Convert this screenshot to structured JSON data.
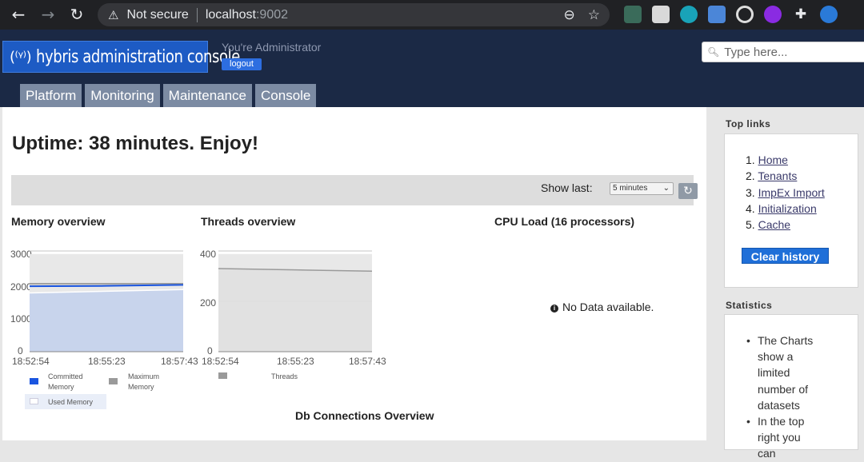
{
  "browser": {
    "security": "Not secure",
    "host": "localhost",
    "port": ":9002"
  },
  "header": {
    "logo_text": "hybris administration console",
    "user_text": "You're Administrator",
    "logout_label": "logout",
    "search_placeholder": "Type here...",
    "tabs": [
      "Platform",
      "Monitoring",
      "Maintenance",
      "Console"
    ]
  },
  "main": {
    "uptime": "Uptime: 38 minutes. Enjoy!",
    "show_last_label": "Show last:",
    "show_last_value": "5 minutes",
    "memory_title": "Memory overview",
    "threads_title": "Threads overview",
    "cpu_title": "CPU Load (16 processors)",
    "cpu_nodata": "No Data available.",
    "db_title": "Db Connections Overview",
    "x_ticks": [
      "18:52:54",
      "18:55:23",
      "18:57:43"
    ],
    "memory_y_ticks": [
      "3000",
      "2000",
      "1000",
      "0"
    ],
    "threads_y_ticks": [
      "400",
      "200",
      "0"
    ],
    "memory_legend": [
      "Committed Memory",
      "Maximum Memory",
      "Used Memory"
    ],
    "threads_legend": [
      "Threads"
    ]
  },
  "chart_data": [
    {
      "type": "area",
      "title": "Memory overview",
      "x": [
        "18:52:54",
        "18:55:23",
        "18:57:43"
      ],
      "ylim": [
        0,
        3000
      ],
      "series": [
        {
          "name": "Committed Memory",
          "values": [
            1950,
            1960,
            1990
          ]
        },
        {
          "name": "Maximum Memory",
          "values": [
            2030,
            2030,
            2030
          ]
        },
        {
          "name": "Used Memory",
          "values": [
            1750,
            1800,
            1850
          ]
        }
      ],
      "colors": {
        "Committed Memory": "#1a55e0",
        "Maximum Memory": "#9a9a9a",
        "Used Memory": "#c8d4ec"
      }
    },
    {
      "type": "area",
      "title": "Threads overview",
      "x": [
        "18:52:54",
        "18:55:23",
        "18:57:43"
      ],
      "ylim": [
        0,
        400
      ],
      "series": [
        {
          "name": "Threads",
          "values": [
            330,
            325,
            320
          ]
        }
      ],
      "colors": {
        "Threads": "#9a9a9a"
      }
    }
  ],
  "sidebar": {
    "top_links_title": "Top links",
    "links": [
      "Home",
      "Tenants",
      "ImpEx Import",
      "Initialization",
      "Cache"
    ],
    "clear_history": "Clear history",
    "statistics_title": "Statistics",
    "stats_lines": [
      "The Charts",
      "show a",
      "limited",
      "number of",
      "datasets",
      "In the top",
      "right you can"
    ]
  }
}
